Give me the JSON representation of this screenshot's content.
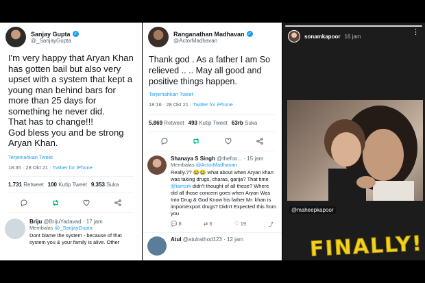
{
  "tweet1": {
    "name": "Sanjay Gupta",
    "handle": "@_SanjayGupta",
    "body": "I'm very happy that Aryan Khan has gotten bail but also very upset with a system that kept a young man behind bars for more than 25 days for something he never did.\nThat has to change!!!\nGod bless you and be strong Aryan Khan.",
    "translate": "Terjemahkan Tweet",
    "time": "18:35 · 28 Okt 21 · ",
    "source": "Twitter for iPhone",
    "retweets": "1.731",
    "retweets_label": "Retweet",
    "quotes": "100",
    "quotes_label": "Kutip Tweet",
    "likes": "9.353",
    "likes_label": "Suka",
    "reply": {
      "name": "Briju",
      "handle": "@BrijuYadavad · 17 jam",
      "to_prefix": "Membalas ",
      "to_handle": "@_SanjayGupta",
      "text": "Dont blame the system - because of that system you & your family is alive. Other"
    }
  },
  "tweet2": {
    "name": "Ranganathan Madhavan",
    "handle": "@ActorMadhavan",
    "body": "Thank god . As a father I am So relieved .. .. May all good and positive things happen.",
    "translate": "Terjemahkan Tweet",
    "time": "18:16 · 28 Okt 21 · ",
    "source": "Twitter for iPhone",
    "retweets": "5.869",
    "retweets_label": "Retweet",
    "quotes": "493",
    "quotes_label": "Kutip Tweet",
    "likes": "63rb",
    "likes_label": "Suka",
    "reply": {
      "name": "Shanaya S Singh",
      "handle": "@thefoo... · 15 jam",
      "to_prefix": "Membalas ",
      "to_handle": "@ActorMadhavan",
      "text_before": "Really.?? 😂😂 what about when Aryan khan was taking drugs, charas, ganja? That time ",
      "mention": "@iamsrk",
      "text_after": " didn't thought of all these? Where did all those concern goes when Aryan Was Into Drug & God Know his father Mr. khan is import/export drugs? Didn't Expected this from you",
      "reply_count": "8",
      "retweet_count": "6",
      "like_count": "19"
    },
    "reply2": {
      "name": "Atul",
      "handle": "@atulrathod123 · 12 jam"
    }
  },
  "story": {
    "username": "sonamkapoor",
    "time": "16 jam",
    "tag": "@maheepkapoor",
    "sticker": "FINALLY!"
  },
  "colors": {
    "accent": "#1d9bf0",
    "retweet_green": "#00ba7c",
    "sticker_yellow": "#f2d21b"
  }
}
